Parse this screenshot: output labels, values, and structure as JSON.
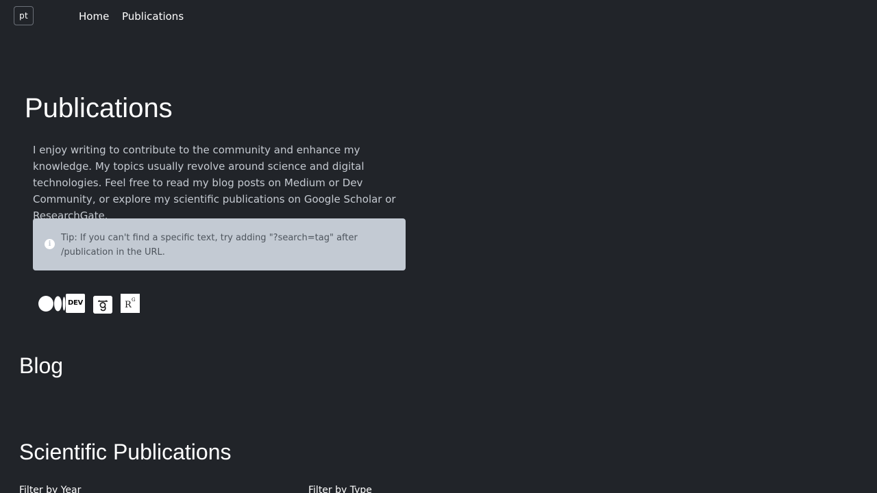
{
  "nav": {
    "logo_text": "pt",
    "links": [
      {
        "label": "Home"
      },
      {
        "label": "Publications"
      }
    ]
  },
  "page": {
    "title": "Publications",
    "intro": "I enjoy writing to contribute to the community and enhance my knowledge. My topics usually revolve around science and digital technologies. Feel free to read my blog posts on Medium or Dev Community, or explore my scientific publications on Google Scholar or ResearchGate."
  },
  "tip": {
    "icon": "info-icon",
    "text": "Tip: If you can't find a specific text, try adding \"?search=tag\" after /publication in the URL."
  },
  "socials": [
    {
      "name": "Medium",
      "icon": "medium-icon"
    },
    {
      "name": "Dev Community",
      "icon": "dev-icon",
      "glyph": "DEV"
    },
    {
      "name": "Google Scholar",
      "icon": "google-scholar-icon"
    },
    {
      "name": "ResearchGate",
      "icon": "researchgate-icon"
    }
  ],
  "sections": {
    "blog_title": "Blog",
    "scientific_title": "Scientific Publications",
    "filter_year_label": "Filter by Year",
    "filter_type_label": "Filter by Type"
  },
  "colors": {
    "background": "#212429",
    "tip_background": "#c3cad3",
    "text_primary": "#ffffff",
    "text_secondary": "#c5cad1"
  }
}
